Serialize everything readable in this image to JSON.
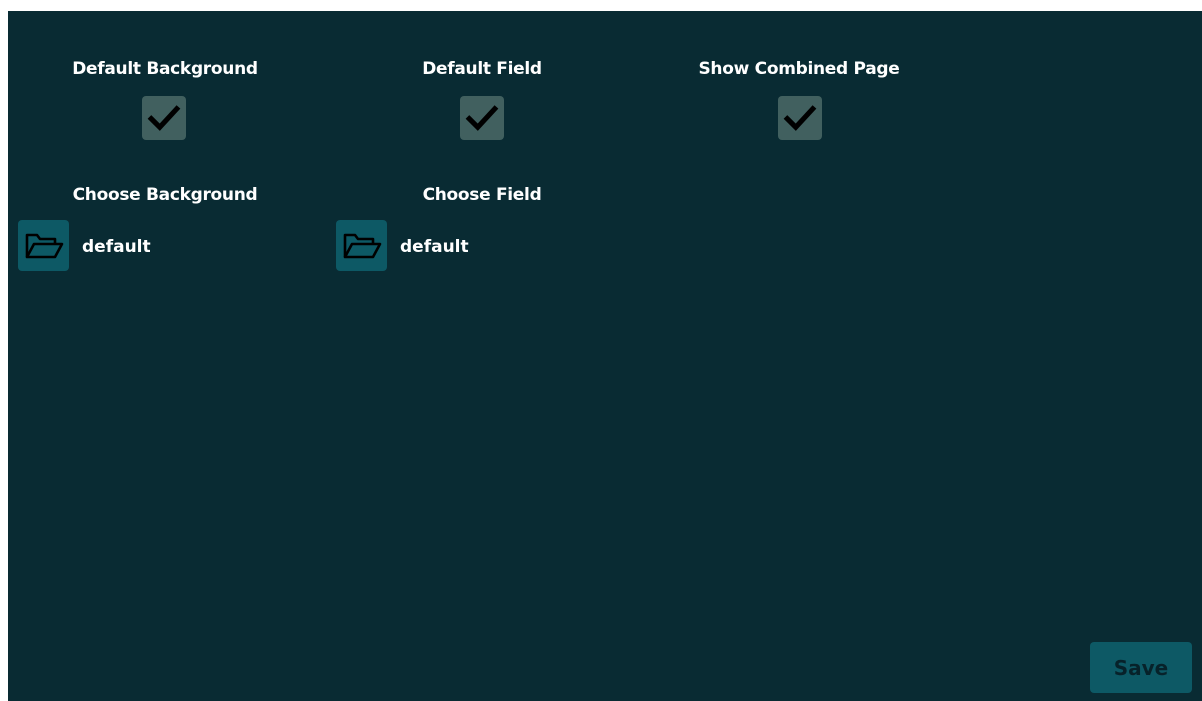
{
  "settings": {
    "default_background": {
      "label": "Default Background",
      "checked": true
    },
    "default_field": {
      "label": "Default Field",
      "checked": true
    },
    "show_combined_page": {
      "label": "Show Combined Page",
      "checked": true
    },
    "choose_background": {
      "label": "Choose Background",
      "value": "default",
      "icon": "folder-open-icon"
    },
    "choose_field": {
      "label": "Choose Field",
      "value": "default",
      "icon": "folder-open-icon"
    }
  },
  "actions": {
    "save_label": "Save"
  },
  "colors": {
    "background": "#092b33",
    "checkbox_fill": "#41605f",
    "button_fill": "#0d5965",
    "text": "#ffffff",
    "save_text": "#07222a"
  }
}
